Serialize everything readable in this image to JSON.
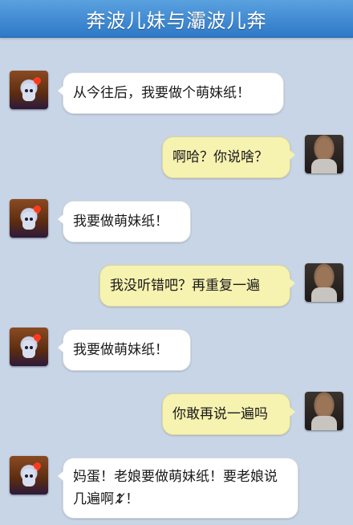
{
  "header": {
    "title": "奔波儿妹与灞波儿奔"
  },
  "messages": [
    {
      "sender": "girl",
      "text": "从今往后，我要做个萌妹纸！"
    },
    {
      "sender": "man",
      "text": "啊哈？你说啥？"
    },
    {
      "sender": "girl",
      "text": "我要做萌妹纸！"
    },
    {
      "sender": "man",
      "text": "我没听错吧？再重复一遍"
    },
    {
      "sender": "girl",
      "text": "我要做萌妹纸！"
    },
    {
      "sender": "man",
      "text": "你敢再说一遍吗"
    },
    {
      "sender": "girl",
      "text": "妈蛋！老娘要做萌妹纸！要老娘说几遍啊­↕̸！"
    }
  ],
  "icons": {
    "girl_avatar": "girl-avatar-icon",
    "man_avatar": "man-avatar-icon"
  },
  "colors": {
    "header": "#3f8bd4",
    "background": "#c8d5e6",
    "left_bubble": "#ffffff",
    "right_bubble": "#f6f2b0"
  }
}
